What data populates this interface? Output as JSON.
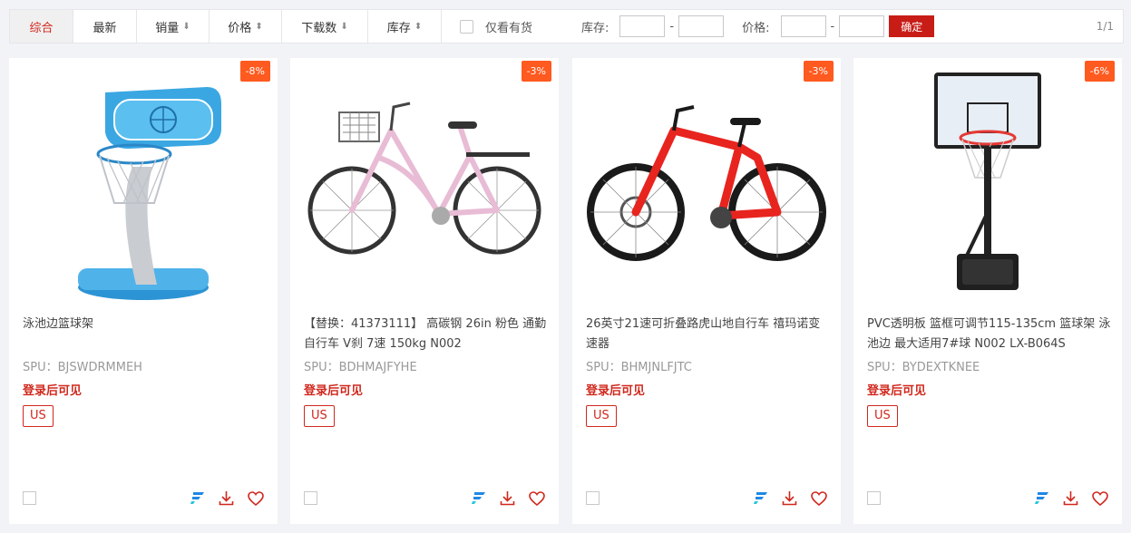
{
  "toolbar": {
    "tabs": [
      {
        "label": "综合",
        "arrow": ""
      },
      {
        "label": "最新",
        "arrow": ""
      },
      {
        "label": "销量",
        "arrow": "⬇"
      },
      {
        "label": "价格",
        "arrow": "⬍"
      },
      {
        "label": "下载数",
        "arrow": "⬇"
      },
      {
        "label": "库存",
        "arrow": "⬍"
      }
    ],
    "in_stock_label": "仅看有货",
    "stock_label": "库存:",
    "price_label": "价格:",
    "dash": "-",
    "confirm_label": "确定",
    "pagination": "1/1"
  },
  "products": [
    {
      "discount": "-8%",
      "title": "泳池边篮球架",
      "spu": "SPU：BJSWDRMMEH",
      "login_text": "登录后可见",
      "region": "US"
    },
    {
      "discount": "-3%",
      "title": "【替换：41373111】 高碳钢 26in 粉色 通勤自行车 V刹 7速 150kg N002",
      "spu": "SPU：BDHMAJFYHE",
      "login_text": "登录后可见",
      "region": "US"
    },
    {
      "discount": "-3%",
      "title": "26英寸21速可折叠路虎山地自行车 禧玛诺变速器",
      "spu": "SPU：BHMJNLFJTC",
      "login_text": "登录后可见",
      "region": "US"
    },
    {
      "discount": "-6%",
      "title": "PVC透明板 篮框可调节115-135cm 篮球架 泳池边 最大适用7#球 N002 LX-B064S",
      "spu": "SPU：BYDEXTKNEE",
      "login_text": "登录后可见",
      "region": "US"
    }
  ],
  "icons": {
    "brand": "f-logo-icon",
    "download": "download-icon",
    "favorite": "heart-icon"
  },
  "colors": {
    "accent": "#d0281d",
    "discount": "#ff5a1f",
    "confirm": "#c81d17"
  }
}
